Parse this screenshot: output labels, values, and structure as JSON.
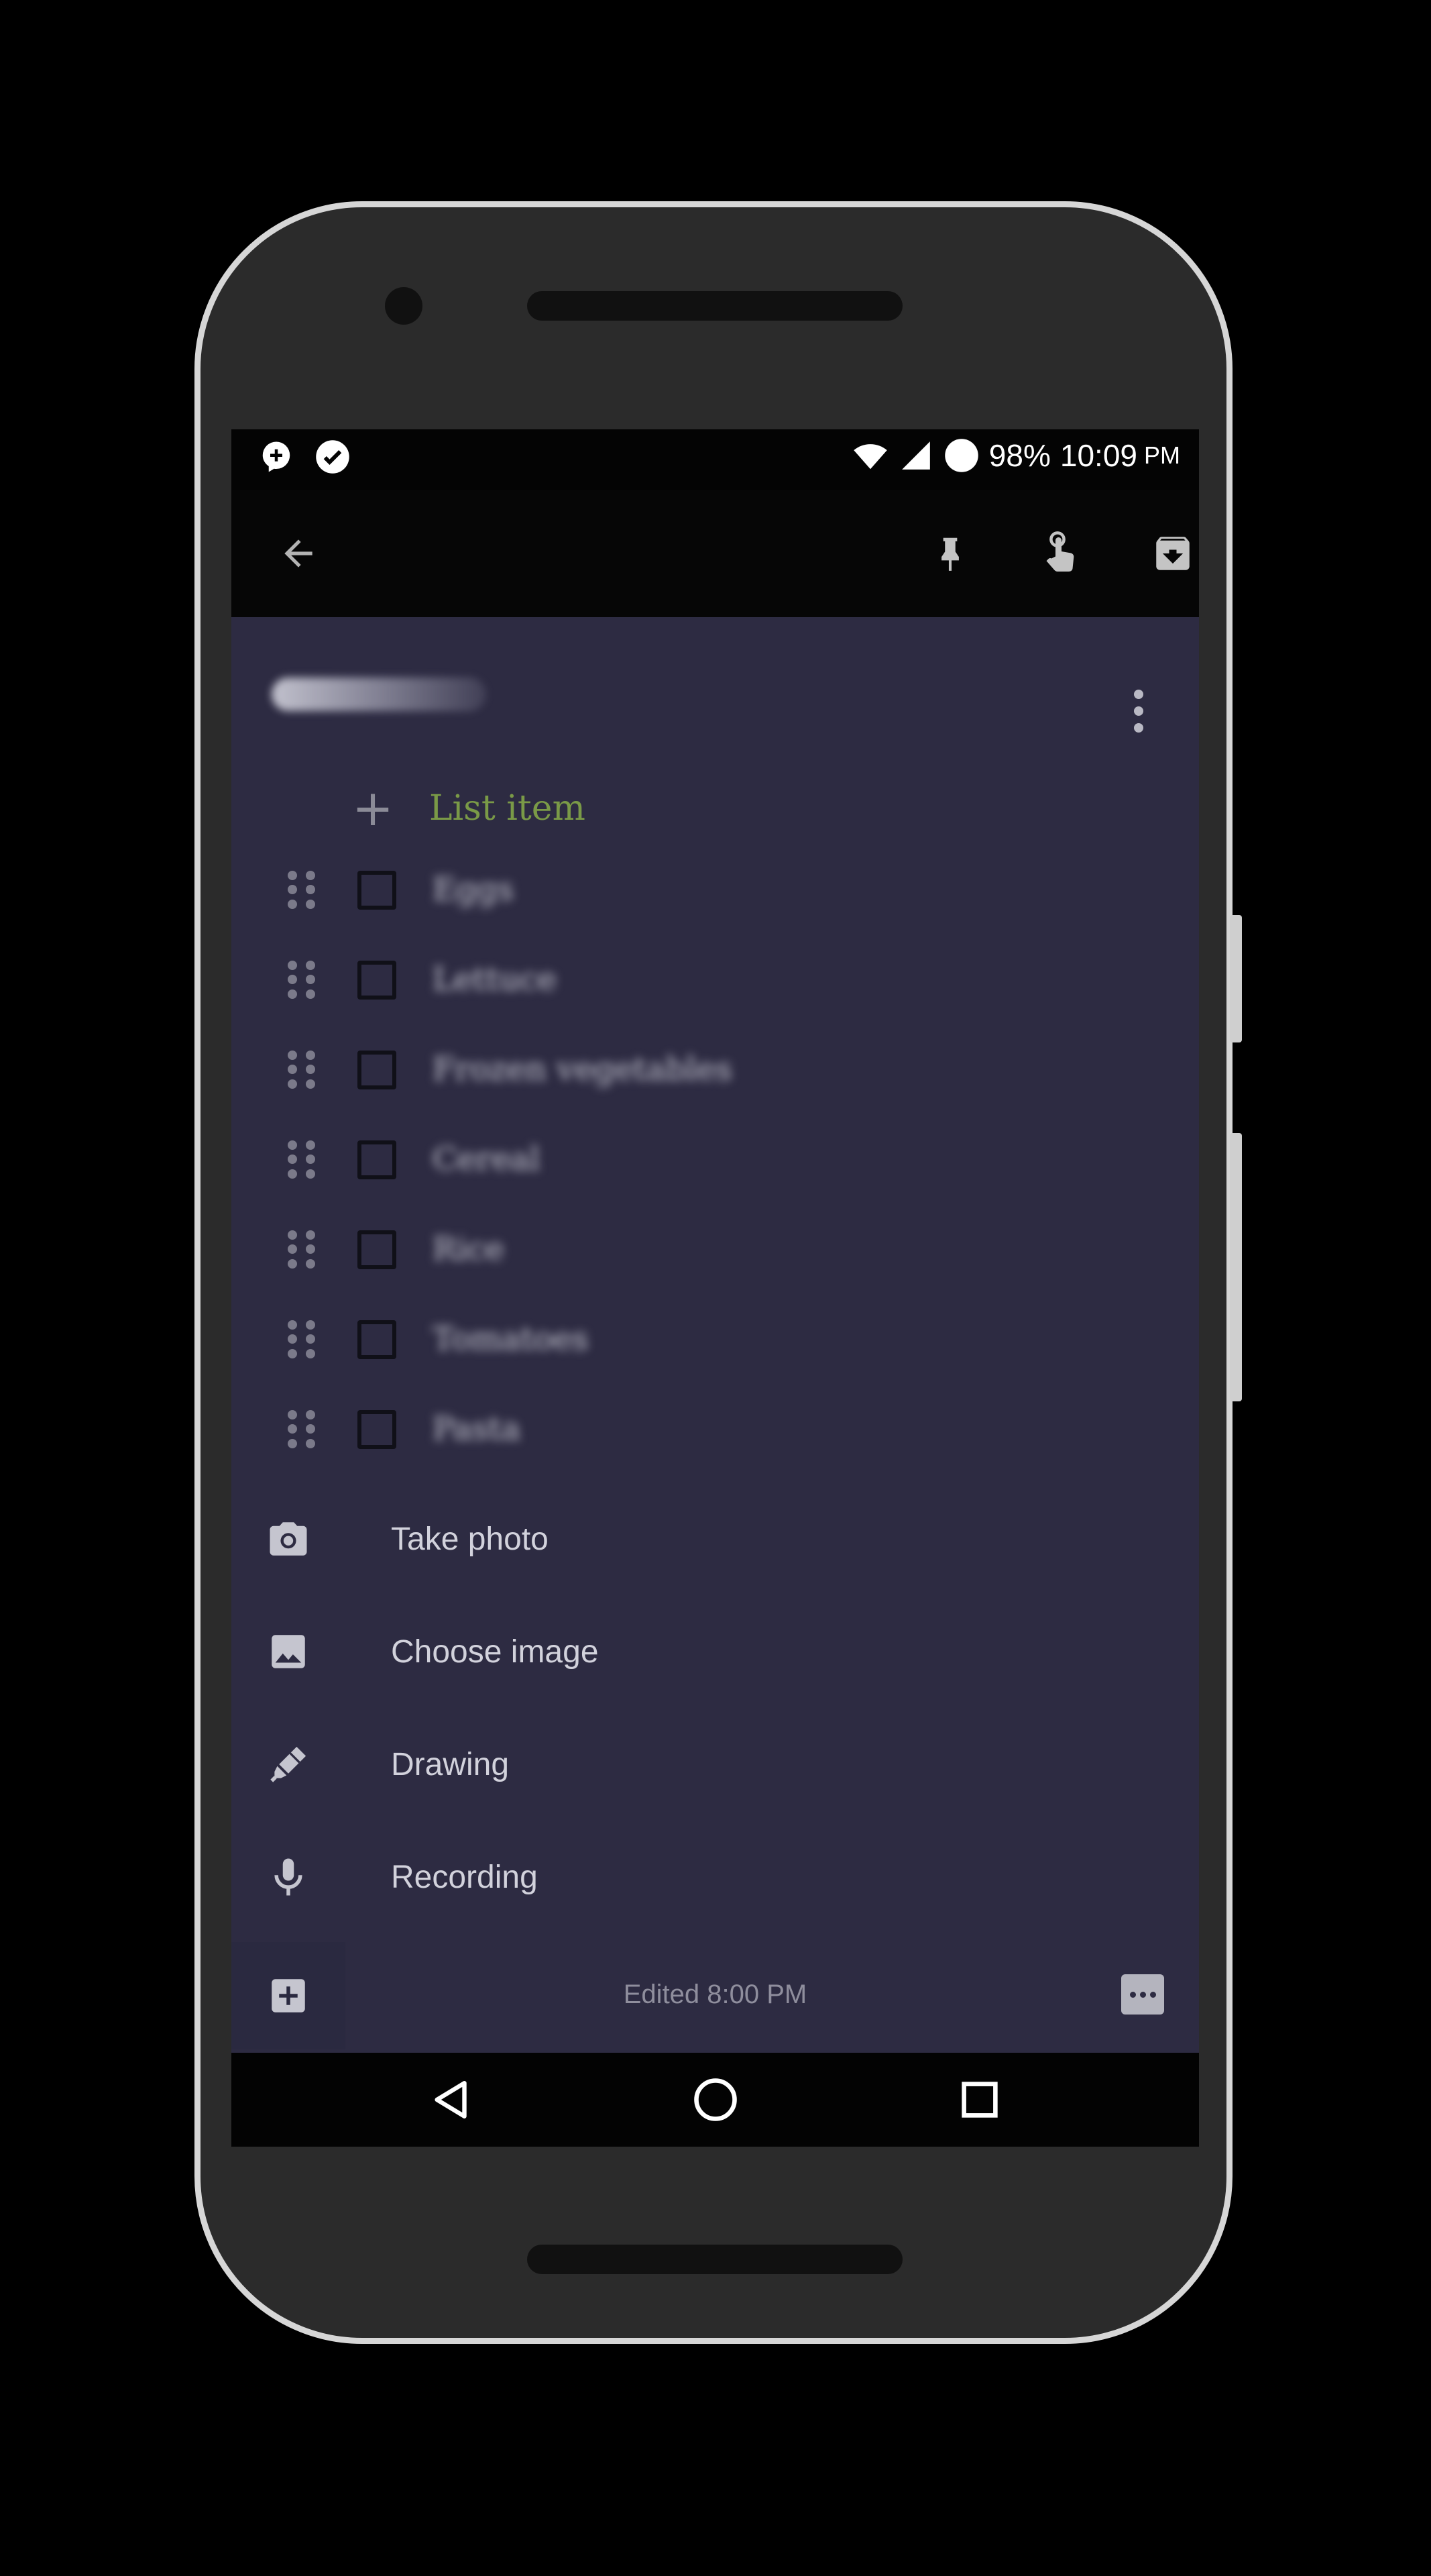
{
  "status_bar": {
    "battery": "98%",
    "time": "10:09",
    "ampm": "PM"
  },
  "note": {
    "title": "Groceries",
    "add_item_label": "List item",
    "items": [
      {
        "text": "Eggs",
        "checked": false
      },
      {
        "text": "Lettuce",
        "checked": false
      },
      {
        "text": "Frozen vegetables",
        "checked": false
      },
      {
        "text": "Cereal",
        "checked": false
      },
      {
        "text": "Rice",
        "checked": false
      },
      {
        "text": "Tomatoes",
        "checked": false
      },
      {
        "text": "Pasta",
        "checked": false
      }
    ]
  },
  "add_menu": {
    "take_photo": "Take photo",
    "choose_image": "Choose image",
    "drawing": "Drawing",
    "recording": "Recording"
  },
  "footer": {
    "edited": "Edited 8:00 PM"
  },
  "colors": {
    "note_background": "#2d2b42",
    "add_item_accent": "#7a9a47"
  }
}
